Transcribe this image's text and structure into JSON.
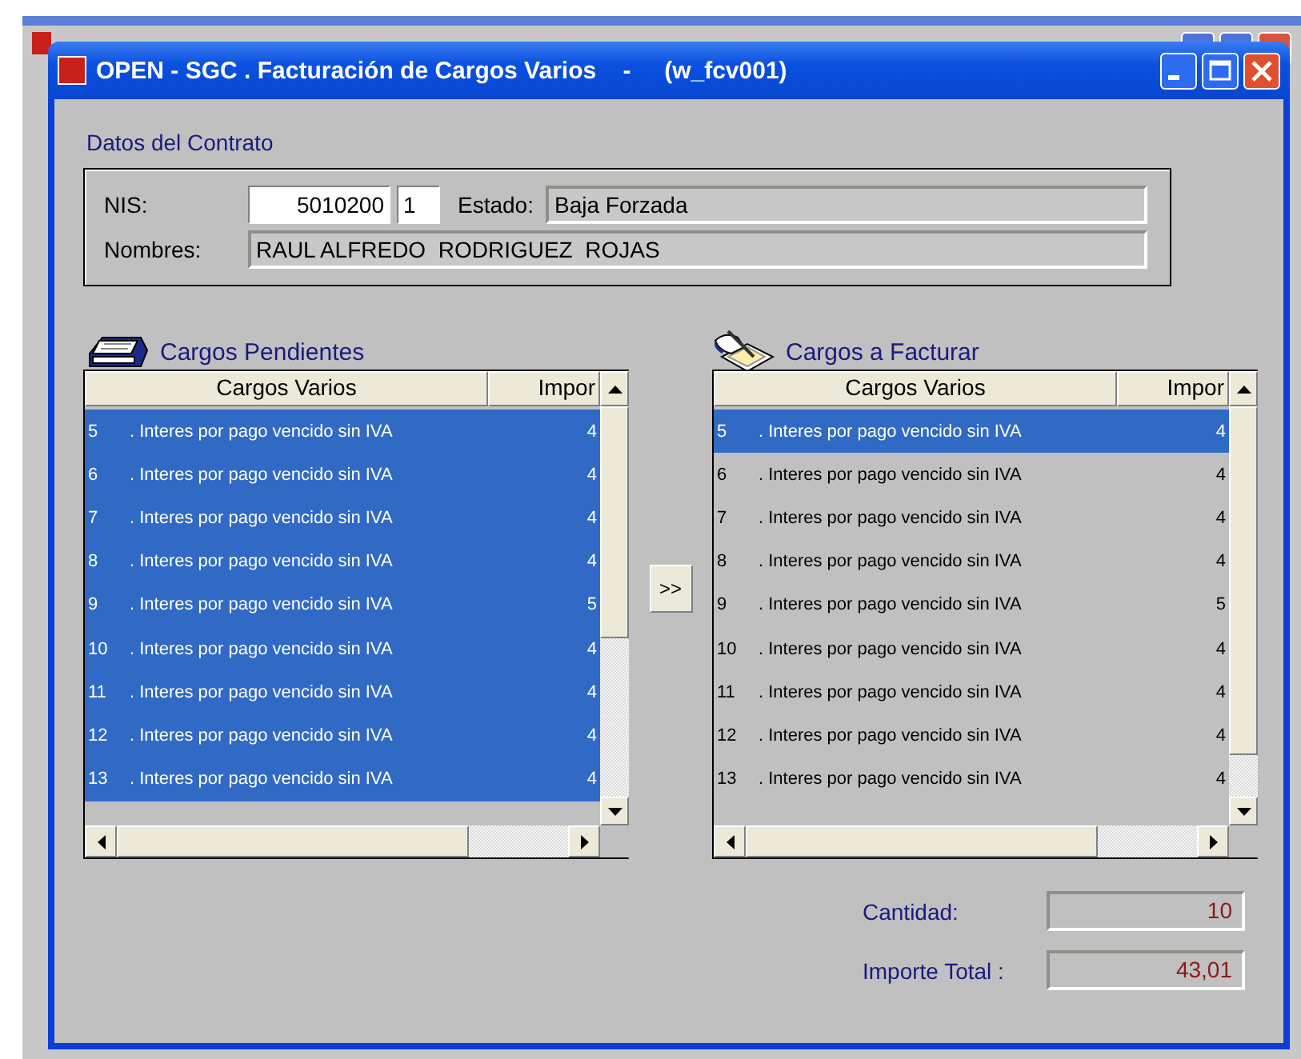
{
  "window": {
    "title": "OPEN - SGC . Facturación de Cargos Varios    -     (w_fcv001)"
  },
  "contract": {
    "section_title": "Datos del Contrato",
    "nis_label": "NIS:",
    "nis": "5010200",
    "nis_suffix": "1",
    "estado_label": "Estado:",
    "estado": "Baja Forzada",
    "nombres_label": "Nombres:",
    "nombres": "RAUL ALFREDO  RODRIGUEZ  ROJAS"
  },
  "lists": [
    {
      "kind": "pending",
      "title": "Cargos Pendientes",
      "columns": [
        "Cargos Varios",
        "Impor"
      ],
      "rows": [
        {
          "number": "5",
          "description": ". Interes por pago vencido sin IVA",
          "amount": "4",
          "selected": true
        },
        {
          "number": "6",
          "description": ". Interes por pago vencido sin IVA",
          "amount": "4",
          "selected": true
        },
        {
          "number": "7",
          "description": ". Interes por pago vencido sin IVA",
          "amount": "4",
          "selected": true
        },
        {
          "number": "8",
          "description": ". Interes por pago vencido sin IVA",
          "amount": "4",
          "selected": true
        },
        {
          "number": "9",
          "description": ". Interes por pago vencido sin IVA",
          "amount": "5",
          "selected": true
        },
        {
          "number": "10",
          "description": ". Interes por pago vencido sin IVA",
          "amount": "4",
          "selected": true
        },
        {
          "number": "11",
          "description": ". Interes por pago vencido sin IVA",
          "amount": "4",
          "selected": true
        },
        {
          "number": "12",
          "description": ". Interes por pago vencido sin IVA",
          "amount": "4",
          "selected": true
        },
        {
          "number": "13",
          "description": ". Interes por pago vencido sin IVA",
          "amount": "4",
          "selected": true
        }
      ]
    },
    {
      "kind": "billing",
      "title": "Cargos a Facturar",
      "columns": [
        "Cargos Varios",
        "Impor"
      ],
      "rows": [
        {
          "number": "5",
          "description": ". Interes por pago vencido sin IVA",
          "amount": "4",
          "selected": true
        },
        {
          "number": "6",
          "description": ". Interes por pago vencido sin IVA",
          "amount": "4",
          "selected": false
        },
        {
          "number": "7",
          "description": ". Interes por pago vencido sin IVA",
          "amount": "4",
          "selected": false
        },
        {
          "number": "8",
          "description": ". Interes por pago vencido sin IVA",
          "amount": "4",
          "selected": false
        },
        {
          "number": "9",
          "description": ". Interes por pago vencido sin IVA",
          "amount": "5",
          "selected": false
        },
        {
          "number": "10",
          "description": ". Interes por pago vencido sin IVA",
          "amount": "4",
          "selected": false
        },
        {
          "number": "11",
          "description": ". Interes por pago vencido sin IVA",
          "amount": "4",
          "selected": false
        },
        {
          "number": "12",
          "description": ". Interes por pago vencido sin IVA",
          "amount": "4",
          "selected": false
        },
        {
          "number": "13",
          "description": ". Interes por pago vencido sin IVA",
          "amount": "4",
          "selected": false
        }
      ]
    }
  ],
  "transfer_button": ">>",
  "totals": {
    "cantidad_label": "Cantidad:",
    "cantidad": "10",
    "importe_label": "Importe Total :",
    "importe": "43,01"
  }
}
